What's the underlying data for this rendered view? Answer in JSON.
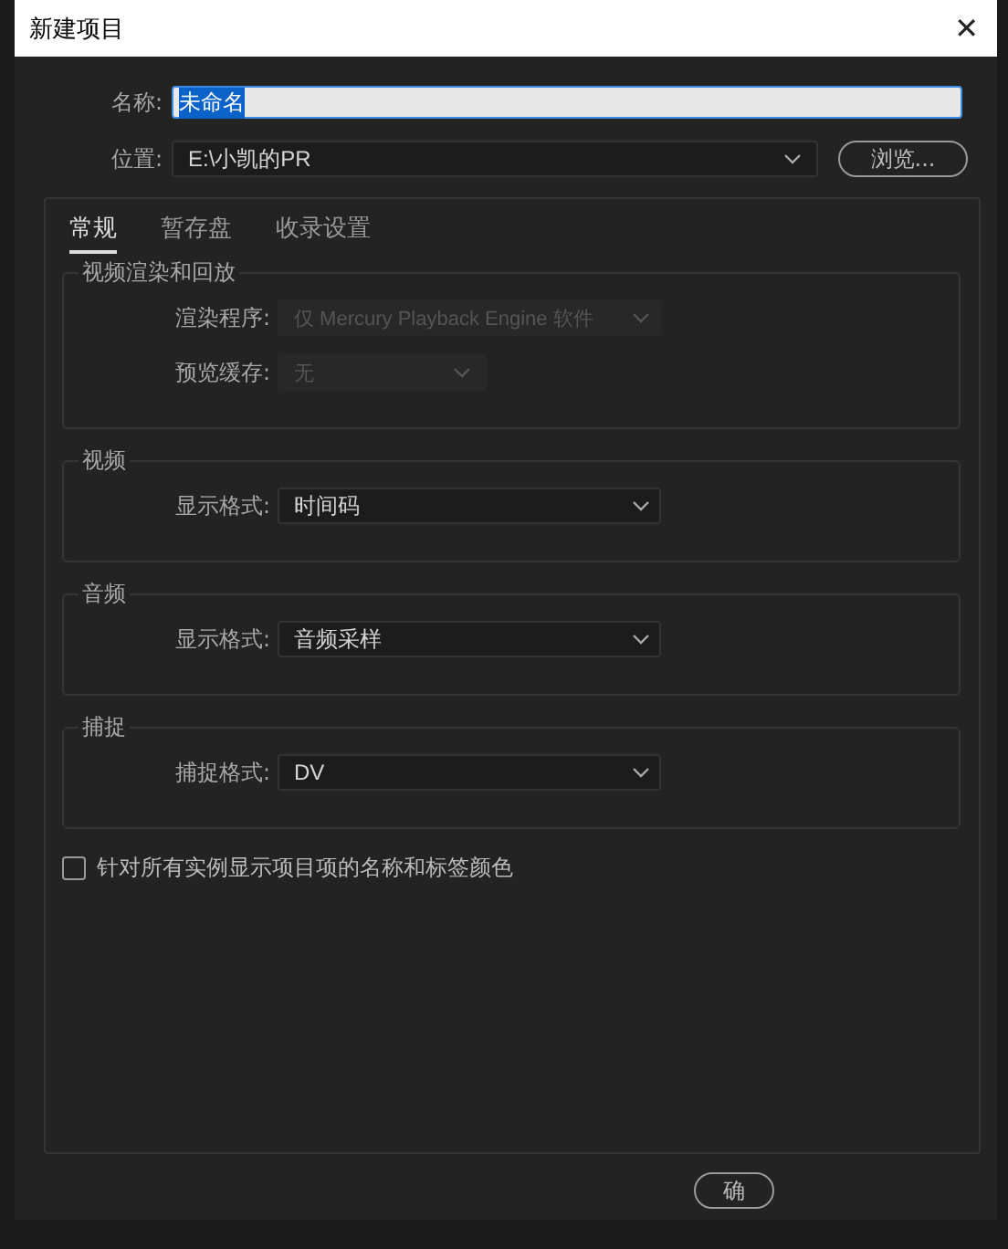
{
  "window": {
    "title": "新建项目",
    "close": "✕"
  },
  "name_field": {
    "label": "名称:",
    "value": "未命名",
    "selected_text": true
  },
  "location": {
    "label": "位置:",
    "value": "E:\\小凯的PR",
    "button": "浏览..."
  },
  "tabs": [
    {
      "label": "常规",
      "selected": true
    },
    {
      "label": "暂存盘",
      "selected": false
    },
    {
      "label": "收录设置",
      "selected": false
    }
  ],
  "groups": [
    {
      "title": "视频渲染和回放",
      "rows": [
        {
          "label": "渲染程序:",
          "value": "仅 Mercury Playback Engine 软件",
          "disabled": true,
          "kind": "wide"
        },
        {
          "label": "预览缓存:",
          "value": "无",
          "disabled": true,
          "kind": "narrow"
        }
      ]
    },
    {
      "title": "视频",
      "rows": [
        {
          "label": "显示格式:",
          "value": "时间码",
          "disabled": false,
          "kind": "wide"
        }
      ]
    },
    {
      "title": "音频",
      "rows": [
        {
          "label": "显示格式:",
          "value": "音频采样",
          "disabled": false,
          "kind": "wide"
        }
      ]
    },
    {
      "title": "捕捉",
      "rows": [
        {
          "label": "捕捉格式:",
          "value": "DV",
          "disabled": false,
          "kind": "wide"
        }
      ]
    }
  ],
  "option": {
    "label": "针对所有实例显示项目项的名称和标签颜色",
    "checked": false
  },
  "buttons": [
    "确"
  ]
}
